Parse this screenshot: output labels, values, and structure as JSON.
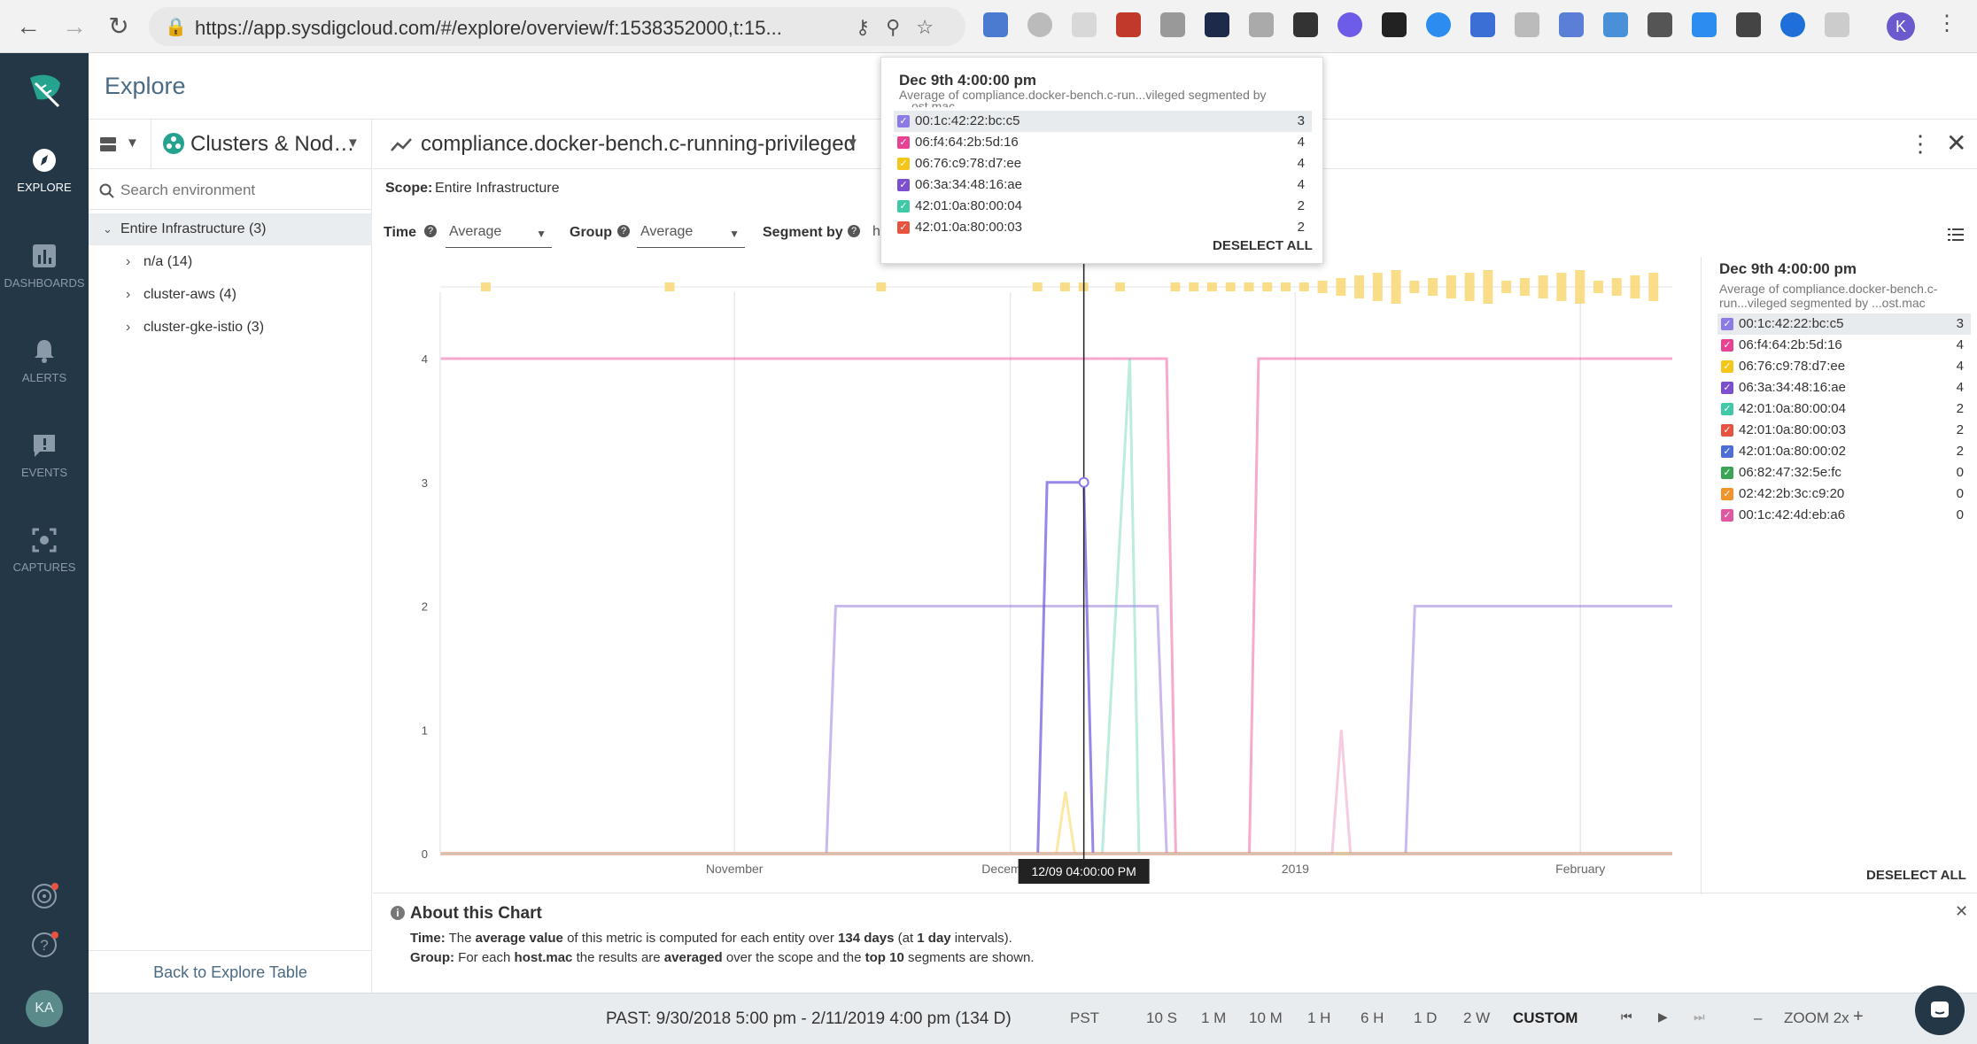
{
  "browser": {
    "url": "https://app.sysdigcloud.com/#/explore/overview/f:1538352000,t:15...",
    "profile_initial": "K"
  },
  "sidebar": {
    "items": [
      {
        "label": "EXPLORE",
        "icon": "compass-icon"
      },
      {
        "label": "DASHBOARDS",
        "icon": "dashboard-icon"
      },
      {
        "label": "ALERTS",
        "icon": "bell-icon"
      },
      {
        "label": "EVENTS",
        "icon": "events-icon"
      },
      {
        "label": "CAPTURES",
        "icon": "capture-icon"
      }
    ],
    "user_initials": "KA"
  },
  "header": {
    "title": "Explore"
  },
  "left_panel": {
    "grouping": "Clusters & Nod…",
    "search_placeholder": "Search environment",
    "tree": [
      {
        "label": "Entire Infrastructure (3)",
        "expanded": true
      },
      {
        "label": "n/a (14)"
      },
      {
        "label": "cluster-aws (4)"
      },
      {
        "label": "cluster-gke-istio (3)"
      }
    ],
    "back_link": "Back to Explore Table"
  },
  "metric": {
    "title": "compliance.docker-bench.c-running-privileged"
  },
  "scope": {
    "label": "Scope:",
    "value": "Entire Infrastructure"
  },
  "controls": {
    "time_label": "Time",
    "time_value": "Average",
    "group_label": "Group",
    "group_value": "Average",
    "segment_label": "Segment by",
    "segment_value": "ho"
  },
  "legend": {
    "title": "Dec 9th 4:00:00 pm",
    "subtitle": "Average of compliance.docker-bench.c-run...vileged segmented by ...ost.mac",
    "deselect": "DESELECT ALL"
  },
  "tooltip": {
    "title": "Dec 9th 4:00:00 pm",
    "subtitle": "Average of compliance.docker-bench.c-run...vileged segmented by",
    "subtitle_cut": "ost.mac",
    "deselect": "DESELECT ALL",
    "rows": 6
  },
  "cursor_label": "12/09 04:00:00 PM",
  "about": {
    "title": "About this Chart",
    "time_label": "Time:",
    "time_pre": "The ",
    "time_bold1": "average value",
    "time_mid": " of this metric is computed for each entity over ",
    "time_bold2": "134 days",
    "time_mid2": " (at ",
    "time_bold3": "1 day",
    "time_end": " intervals).",
    "group_label": "Group:",
    "group_pre": "For each ",
    "group_bold1": "host.mac",
    "group_mid": " the results are ",
    "group_bold2": "averaged",
    "group_mid2": " over the scope and the ",
    "group_bold3": "top 10",
    "group_end": " segments are shown."
  },
  "time_nav": {
    "range": "PAST: 9/30/2018 5:00 pm - 2/11/2019 4:00 pm (134 D)",
    "timezone": "PST",
    "presets": [
      "10 S",
      "1 M",
      "10 M",
      "1 H",
      "6 H",
      "1 D",
      "2 W"
    ],
    "custom": "CUSTOM",
    "zoom": "ZOOM 2x",
    "minus": "–",
    "plus": "+"
  },
  "chart_data": {
    "type": "line",
    "title": "",
    "xlabel": "",
    "ylabel": "",
    "ylim": [
      0,
      4
    ],
    "yticks": [
      0,
      1,
      2,
      3,
      4
    ],
    "xlim": [
      "2018-09-30",
      "2019-02-11"
    ],
    "xticks": [
      {
        "label": "November",
        "date": "2018-11-01"
      },
      {
        "label": "December",
        "date": "2018-12-01"
      },
      {
        "label": "2019",
        "date": "2019-01-01"
      },
      {
        "label": "February",
        "date": "2019-02-01"
      }
    ],
    "grid": true,
    "legend_position": "right",
    "cursor": {
      "date": "2018-12-09",
      "value": 3
    },
    "series": [
      {
        "name": "00:1c:42:22:bc:c5",
        "color": "#8c7ae6",
        "cursor_value": 3,
        "points": [
          [
            "2018-09-30",
            0
          ],
          [
            "2018-12-04",
            0
          ],
          [
            "2018-12-05",
            3
          ],
          [
            "2018-12-09",
            3
          ],
          [
            "2018-12-10",
            0
          ],
          [
            "2019-02-11",
            0
          ]
        ]
      },
      {
        "name": "06:f4:64:2b:5d:16",
        "color": "#e84393",
        "cursor_value": 4,
        "points": [
          [
            "2018-09-30",
            4
          ],
          [
            "2018-12-18",
            4
          ],
          [
            "2018-12-19",
            0
          ],
          [
            "2018-12-27",
            0
          ],
          [
            "2018-12-28",
            4
          ],
          [
            "2019-02-11",
            4
          ]
        ]
      },
      {
        "name": "06:76:c9:78:d7:ee",
        "color": "#f5c518",
        "cursor_value": 4,
        "points": [
          [
            "2018-09-30",
            0
          ],
          [
            "2018-12-06",
            0
          ],
          [
            "2018-12-07",
            0.5
          ],
          [
            "2018-12-08",
            0
          ],
          [
            "2019-02-11",
            0
          ]
        ]
      },
      {
        "name": "06:3a:34:48:16:ae",
        "color": "#7b4fd0",
        "cursor_value": 4,
        "points": [
          [
            "2018-09-30",
            0
          ],
          [
            "2018-11-11",
            0
          ],
          [
            "2018-11-12",
            2
          ],
          [
            "2018-12-17",
            2
          ],
          [
            "2018-12-18",
            0
          ],
          [
            "2019-01-13",
            0
          ],
          [
            "2019-01-14",
            2
          ],
          [
            "2019-02-11",
            2
          ]
        ]
      },
      {
        "name": "42:01:0a:80:00:04",
        "color": "#3fc9a6",
        "cursor_value": 2,
        "points": [
          [
            "2018-09-30",
            0
          ],
          [
            "2018-12-11",
            0
          ],
          [
            "2018-12-14",
            4
          ],
          [
            "2018-12-15",
            0
          ],
          [
            "2019-02-11",
            0
          ]
        ]
      },
      {
        "name": "42:01:0a:80:00:03",
        "color": "#e8533f",
        "cursor_value": 2,
        "points": [
          [
            "2018-09-30",
            0
          ],
          [
            "2019-02-11",
            0
          ]
        ]
      },
      {
        "name": "42:01:0a:80:00:02",
        "color": "#4b6fd6",
        "cursor_value": 2,
        "points": [
          [
            "2018-09-30",
            0
          ],
          [
            "2019-02-11",
            0
          ]
        ]
      },
      {
        "name": "06:82:47:32:5e:fc",
        "color": "#3aa655",
        "cursor_value": 0,
        "points": [
          [
            "2018-09-30",
            0
          ],
          [
            "2019-02-11",
            0
          ]
        ]
      },
      {
        "name": "02:42:2b:3c:c9:20",
        "color": "#f0932b",
        "cursor_value": 0,
        "points": [
          [
            "2018-09-30",
            0
          ],
          [
            "2019-02-11",
            0
          ]
        ]
      },
      {
        "name": "00:1c:42:4d:eb:a6",
        "color": "#e056a0",
        "cursor_value": 0,
        "points": [
          [
            "2018-09-30",
            0
          ],
          [
            "2019-01-05",
            0
          ],
          [
            "2019-01-06",
            1
          ],
          [
            "2019-01-07",
            0
          ],
          [
            "2019-02-11",
            0
          ]
        ]
      }
    ]
  }
}
